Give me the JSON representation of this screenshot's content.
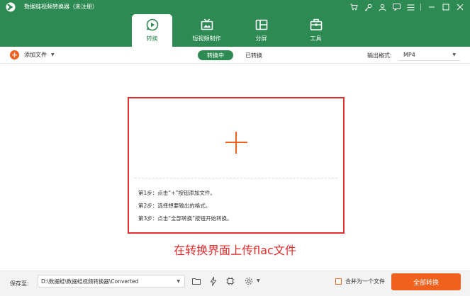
{
  "app": {
    "title": "数据蛙视频转换器（未注册）",
    "logo_icon": "app-logo-icon"
  },
  "window_controls": {
    "icons": [
      "cart-icon",
      "key-icon",
      "user-icon",
      "message-icon",
      "menu-icon",
      "minimize-icon",
      "maximize-icon",
      "close-icon"
    ]
  },
  "tabs": [
    {
      "label": "转换",
      "icon": "convert-icon",
      "active": true
    },
    {
      "label": "短视频制作",
      "icon": "tv-icon",
      "active": false
    },
    {
      "label": "分屏",
      "icon": "split-screen-icon",
      "active": false
    },
    {
      "label": "工具",
      "icon": "toolbox-icon",
      "active": false
    }
  ],
  "toolbar": {
    "add_file_label": "添加文件",
    "status_converting": "转换中",
    "status_converted": "已转换",
    "output_format_label": "输出格式:",
    "output_format_value": "MP4"
  },
  "dropzone": {
    "steps": [
      "第1步：点击“+”按钮添加文件。",
      "第2步：选择想要输出的格式。",
      "第3步：点击“全部转换”按钮开始转换。"
    ]
  },
  "caption": "在转换界面上传flac文件",
  "bottom": {
    "save_to_label": "保存至:",
    "save_path": "D:\\数据蛙\\数据蛙视频转换器\\Converted",
    "merge_label": "合并为一个文件",
    "convert_all_label": "全部转换"
  },
  "colors": {
    "brand_green": "#2d8a53",
    "accent_orange": "#f0611e",
    "annotation_red": "#e22f2f"
  }
}
